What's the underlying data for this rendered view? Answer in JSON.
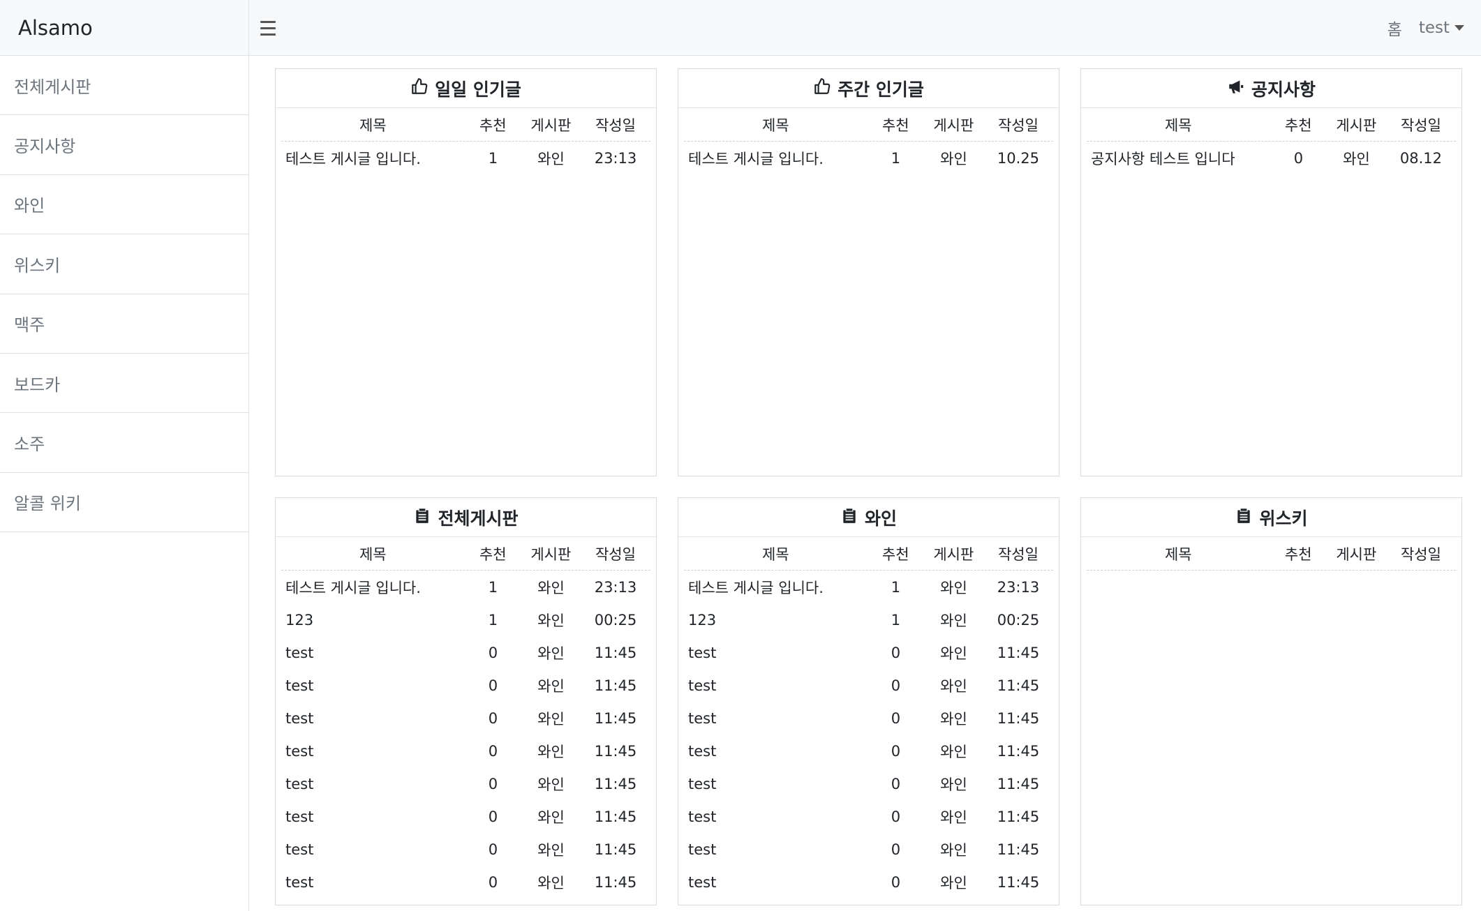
{
  "brand": "Alsamo",
  "nav": {
    "home": "홈",
    "user": "test"
  },
  "sidebar": {
    "items": [
      {
        "label": "전체게시판"
      },
      {
        "label": "공지사항"
      },
      {
        "label": "와인"
      },
      {
        "label": "위스키"
      },
      {
        "label": "맥주"
      },
      {
        "label": "보드카"
      },
      {
        "label": "소주"
      },
      {
        "label": "알콜 위키"
      }
    ]
  },
  "columns": {
    "title": "제목",
    "rec": "추천",
    "board": "게시판",
    "date": "작성일"
  },
  "cards": [
    {
      "title": "일일 인기글",
      "icon": "thumbs-up-icon",
      "rows": [
        {
          "title": "테스트 게시글 입니다.",
          "rec": "1",
          "board": "와인",
          "date": "23:13"
        }
      ]
    },
    {
      "title": "주간 인기글",
      "icon": "thumbs-up-icon",
      "rows": [
        {
          "title": "테스트 게시글 입니다.",
          "rec": "1",
          "board": "와인",
          "date": "10.25"
        }
      ]
    },
    {
      "title": "공지사항",
      "icon": "megaphone-icon",
      "rows": [
        {
          "title": "공지사항 테스트 입니다",
          "rec": "0",
          "board": "와인",
          "date": "08.12"
        }
      ]
    },
    {
      "title": "전체게시판",
      "icon": "clipboard-icon",
      "rows": [
        {
          "title": "테스트 게시글 입니다.",
          "rec": "1",
          "board": "와인",
          "date": "23:13"
        },
        {
          "title": "123",
          "rec": "1",
          "board": "와인",
          "date": "00:25"
        },
        {
          "title": "test",
          "rec": "0",
          "board": "와인",
          "date": "11:45"
        },
        {
          "title": "test",
          "rec": "0",
          "board": "와인",
          "date": "11:45"
        },
        {
          "title": "test",
          "rec": "0",
          "board": "와인",
          "date": "11:45"
        },
        {
          "title": "test",
          "rec": "0",
          "board": "와인",
          "date": "11:45"
        },
        {
          "title": "test",
          "rec": "0",
          "board": "와인",
          "date": "11:45"
        },
        {
          "title": "test",
          "rec": "0",
          "board": "와인",
          "date": "11:45"
        },
        {
          "title": "test",
          "rec": "0",
          "board": "와인",
          "date": "11:45"
        },
        {
          "title": "test",
          "rec": "0",
          "board": "와인",
          "date": "11:45"
        }
      ]
    },
    {
      "title": "와인",
      "icon": "clipboard-icon",
      "rows": [
        {
          "title": "테스트 게시글 입니다.",
          "rec": "1",
          "board": "와인",
          "date": "23:13"
        },
        {
          "title": "123",
          "rec": "1",
          "board": "와인",
          "date": "00:25"
        },
        {
          "title": "test",
          "rec": "0",
          "board": "와인",
          "date": "11:45"
        },
        {
          "title": "test",
          "rec": "0",
          "board": "와인",
          "date": "11:45"
        },
        {
          "title": "test",
          "rec": "0",
          "board": "와인",
          "date": "11:45"
        },
        {
          "title": "test",
          "rec": "0",
          "board": "와인",
          "date": "11:45"
        },
        {
          "title": "test",
          "rec": "0",
          "board": "와인",
          "date": "11:45"
        },
        {
          "title": "test",
          "rec": "0",
          "board": "와인",
          "date": "11:45"
        },
        {
          "title": "test",
          "rec": "0",
          "board": "와인",
          "date": "11:45"
        },
        {
          "title": "test",
          "rec": "0",
          "board": "와인",
          "date": "11:45"
        }
      ]
    },
    {
      "title": "위스키",
      "icon": "clipboard-icon",
      "rows": []
    }
  ]
}
